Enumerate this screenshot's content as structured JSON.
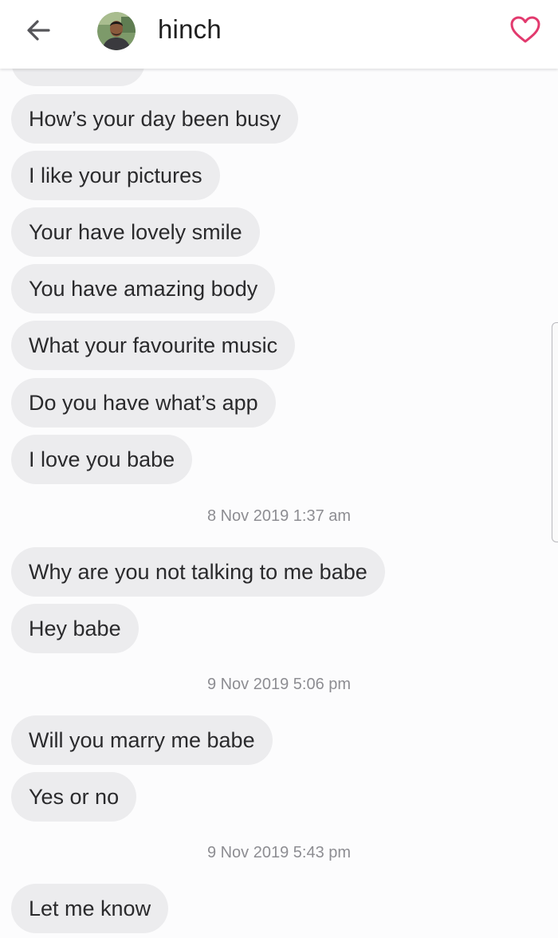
{
  "header": {
    "contact_name": "hinch",
    "back_icon": "arrow-left-icon",
    "like_icon": "heart-outline-icon",
    "accent_color": "#e23a6e"
  },
  "messages": [
    {
      "text": "How’s your day been busy"
    },
    {
      "text": "I like your pictures"
    },
    {
      "text": "Your have lovely smile"
    },
    {
      "text": "You have amazing body"
    },
    {
      "text": "What your favourite music"
    },
    {
      "text": "Do you have what’s app"
    },
    {
      "text": "I love you babe"
    },
    {
      "text": "Why are you not talking to me babe"
    },
    {
      "text": "Hey babe"
    },
    {
      "text": "Will you marry me babe"
    },
    {
      "text": "Yes or no"
    },
    {
      "text": "Let me know"
    }
  ],
  "timestamps": [
    "8 Nov 2019 1:37 am",
    "9 Nov 2019 5:06 pm",
    "9 Nov 2019 5:43 pm"
  ]
}
